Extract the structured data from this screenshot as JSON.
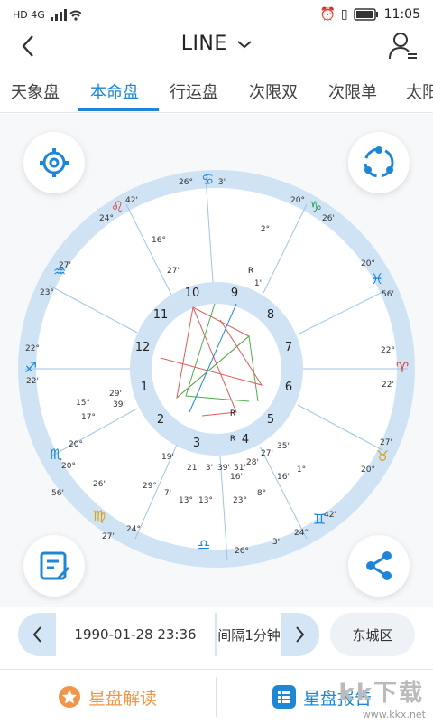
{
  "status_bar": {
    "left_text": "HD 4G",
    "time": "11:05"
  },
  "header": {
    "title": "LINE",
    "back_icon": "chevron-left-icon",
    "user_icon": "user-list-icon"
  },
  "tabs": [
    {
      "label": "天象盘"
    },
    {
      "label": "本命盘",
      "active": true
    },
    {
      "label": "行运盘"
    },
    {
      "label": "次限双"
    },
    {
      "label": "次限单"
    },
    {
      "label": "太阳"
    }
  ],
  "chart": {
    "house_numbers": [
      "1",
      "2",
      "3",
      "4",
      "5",
      "6",
      "7",
      "8",
      "9",
      "10",
      "11",
      "12"
    ],
    "sign_symbols": [
      "♋",
      "♑",
      "♓",
      "♈",
      "♉",
      "♊",
      "♎",
      "♍",
      "♏",
      "♐",
      "♒",
      "♌"
    ],
    "outer_degrees": [
      "26°",
      "3'",
      "20°",
      "26'",
      "20°",
      "56'",
      "22°",
      "22'",
      "27'",
      "20°",
      "42'",
      "24°",
      "26°",
      "3'",
      "27'",
      "24°",
      "20°",
      "56'",
      "22°",
      "22'",
      "27'",
      "23°",
      "42'",
      "24°",
      "20°",
      "26'"
    ],
    "planet_labels": [
      "R",
      "16°",
      "27'",
      "2°",
      "1'",
      "R",
      "15°",
      "29'",
      "39'",
      "17°",
      "R",
      "19'",
      "21'",
      "3'",
      "39'",
      "51'",
      "28'",
      "16'",
      "27'",
      "35'",
      "1°",
      "16'",
      "8°",
      "29°",
      "7'",
      "13°",
      "13°",
      "23°"
    ],
    "accent_color": "#1d87d6"
  },
  "date_bar": {
    "datetime": "1990-01-28 23:36",
    "interval": "间隔1分钟",
    "location": "东城区"
  },
  "bottom_bar": {
    "left_label": "星盘解读",
    "right_label": "星盘报告"
  },
  "watermark": {
    "text": "www.kkx.net",
    "brand": "kk下载"
  }
}
